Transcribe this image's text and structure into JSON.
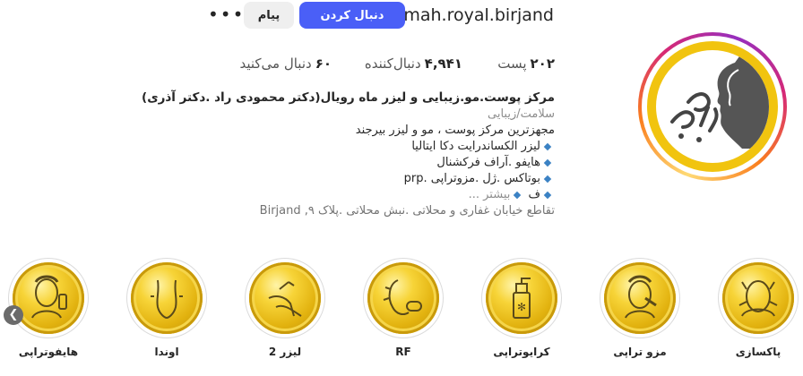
{
  "profile": {
    "username": "mah.royal.birjand",
    "follow_label": "دنبال کردن",
    "message_label": "پیام",
    "more_label": "•••"
  },
  "stats": {
    "posts_count": "۲۰۲",
    "posts_label": "پست",
    "followers_count": "۴,۹۴۱",
    "followers_label": "دنبال‌کننده",
    "following_count": "۶۰",
    "following_label": "دنبال می‌کنید"
  },
  "bio": {
    "name": "مرکز پوست.مو.زیبایی و لیزر ماه رویال(دکتر محمودی راد .دکتر آذری)",
    "category": "سلامت/زیبایی",
    "line1": "مجهزترین مرکز پوست ، مو و لیزر بیرجند",
    "line2": "لیزر الکساندرایت دکا ایتالیا",
    "line3": "هایفو .آراف فرکشنال",
    "line4": "بوتاکس .ژل .مزوتراپی .prp",
    "line5": "ف",
    "more": "بیشتر ...",
    "address": "تقاطع خیابان غفاری و محلاتی .نبش محلاتی .پلاک ۹, Birjand"
  },
  "highlights": [
    {
      "label": "پاکسازی",
      "icon": "face-cleansing-icon"
    },
    {
      "label": "مزو تراپی",
      "icon": "mesotherapy-icon"
    },
    {
      "label": "کرایوتراپی",
      "icon": "cryotherapy-spray-icon"
    },
    {
      "label": "RF",
      "icon": "rf-device-icon"
    },
    {
      "label": "لیزر 2",
      "icon": "laser-legs-icon"
    },
    {
      "label": "اوندا",
      "icon": "body-contour-icon"
    },
    {
      "label": "هایفوتراپی",
      "icon": "hifu-face-icon"
    }
  ],
  "colors": {
    "follow_button": "#4a5ff7",
    "logo_gold": "#f1c40f",
    "bullet_diamond": "#3b82c4"
  }
}
